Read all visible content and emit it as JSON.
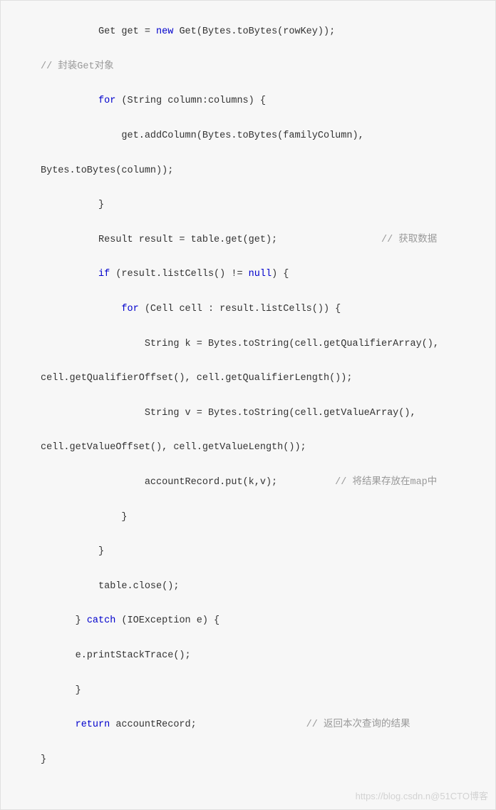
{
  "code": {
    "l1_indent": "          ",
    "l1_get": "Get get = ",
    "l1_new": "new",
    "l1_rest": " Get(Bytes.toBytes(rowKey));",
    "l2_comment": "// 封装Get对象",
    "l3_indent": "          ",
    "l3_for": "for",
    "l3_rest": " (String column:columns) {",
    "l4_text": "              get.addColumn(Bytes.toBytes(familyColumn),",
    "l5_text": "Bytes.toBytes(column));",
    "l6_text": "          }",
    "l7_text": "          Result result = table.get(get);                  ",
    "l7_comment": "// 获取数据",
    "l8_indent": "          ",
    "l8_if": "if",
    "l8_mid": " (result.listCells() != ",
    "l8_null": "null",
    "l8_end": ") {",
    "l9_indent": "              ",
    "l9_for": "for",
    "l9_rest": " (Cell cell : result.listCells()) {",
    "l10_text": "                  String k = Bytes.toString(cell.getQualifierArray(),",
    "l11_text": "cell.getQualifierOffset(), cell.getQualifierLength());",
    "l12_text": "                  String v = Bytes.toString(cell.getValueArray(),",
    "l13_text": "cell.getValueOffset(), cell.getValueLength());",
    "l14_text": "                  accountRecord.put(k,v);          ",
    "l14_comment": "// 将结果存放在map中",
    "l15_text": "              }",
    "l16_text": "          }",
    "l17_text": "          table.close();",
    "l18_indent": "      } ",
    "l18_catch": "catch",
    "l18_rest": " (IOException e) {",
    "l19_text": "      e.printStackTrace();",
    "l20_text": "      }",
    "l21_indent": "      ",
    "l21_return": "return",
    "l21_mid": " accountRecord;                   ",
    "l21_comment": "// 返回本次查询的结果",
    "l22_text": "}"
  },
  "watermark": "https://blog.csdn.n@51CTO博客"
}
